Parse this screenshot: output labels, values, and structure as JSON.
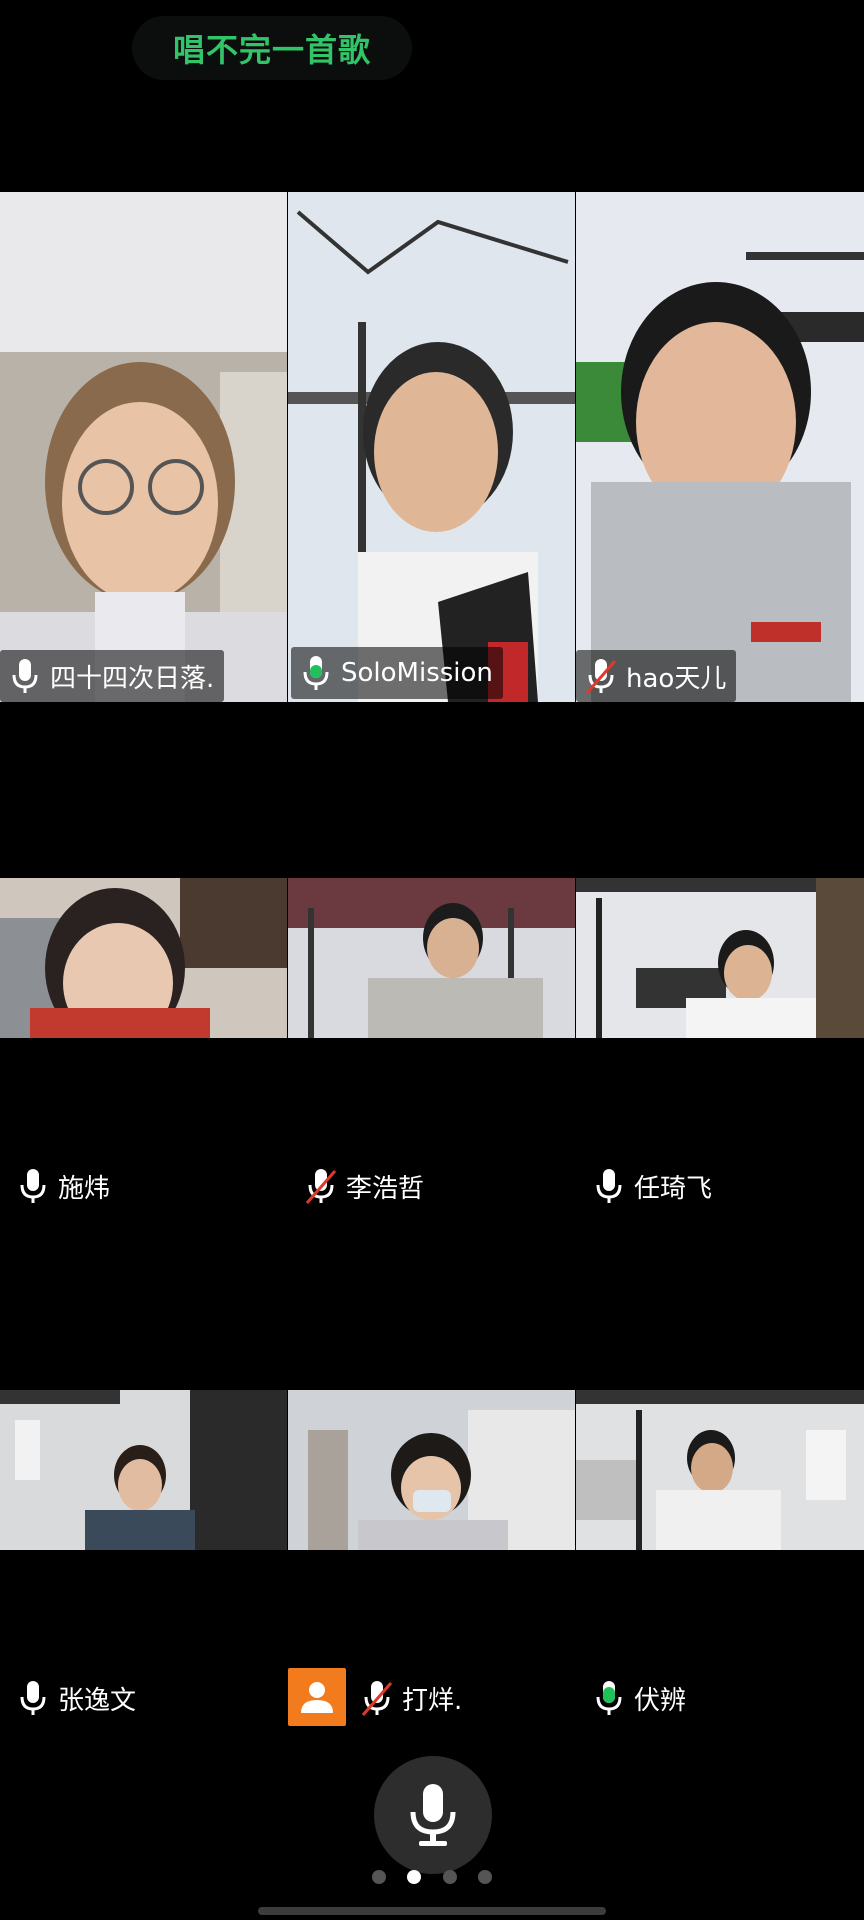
{
  "meeting": {
    "topic": "唱不完一首歌"
  },
  "participants": [
    {
      "name": "四十四次日落.",
      "mic": "on"
    },
    {
      "name": "SoloMission",
      "mic": "speaking",
      "active": true
    },
    {
      "name": "hao天儿",
      "mic": "muted"
    },
    {
      "name": "施炜",
      "mic": "on"
    },
    {
      "name": "李浩哲",
      "mic": "muted"
    },
    {
      "name": "任琦飞",
      "mic": "on"
    },
    {
      "name": "张逸文",
      "mic": "on"
    },
    {
      "name": "打烊.",
      "mic": "muted",
      "avatar": "person-icon"
    },
    {
      "name": "伏辨",
      "mic": "speaking"
    }
  ],
  "colors": {
    "accent": "#20c05a",
    "muted": "#e0392b",
    "avatar_bg": "#f27b1d"
  },
  "controls": {
    "mic_button": "microphone-icon"
  },
  "pager": {
    "pages": 4,
    "current": 2
  }
}
